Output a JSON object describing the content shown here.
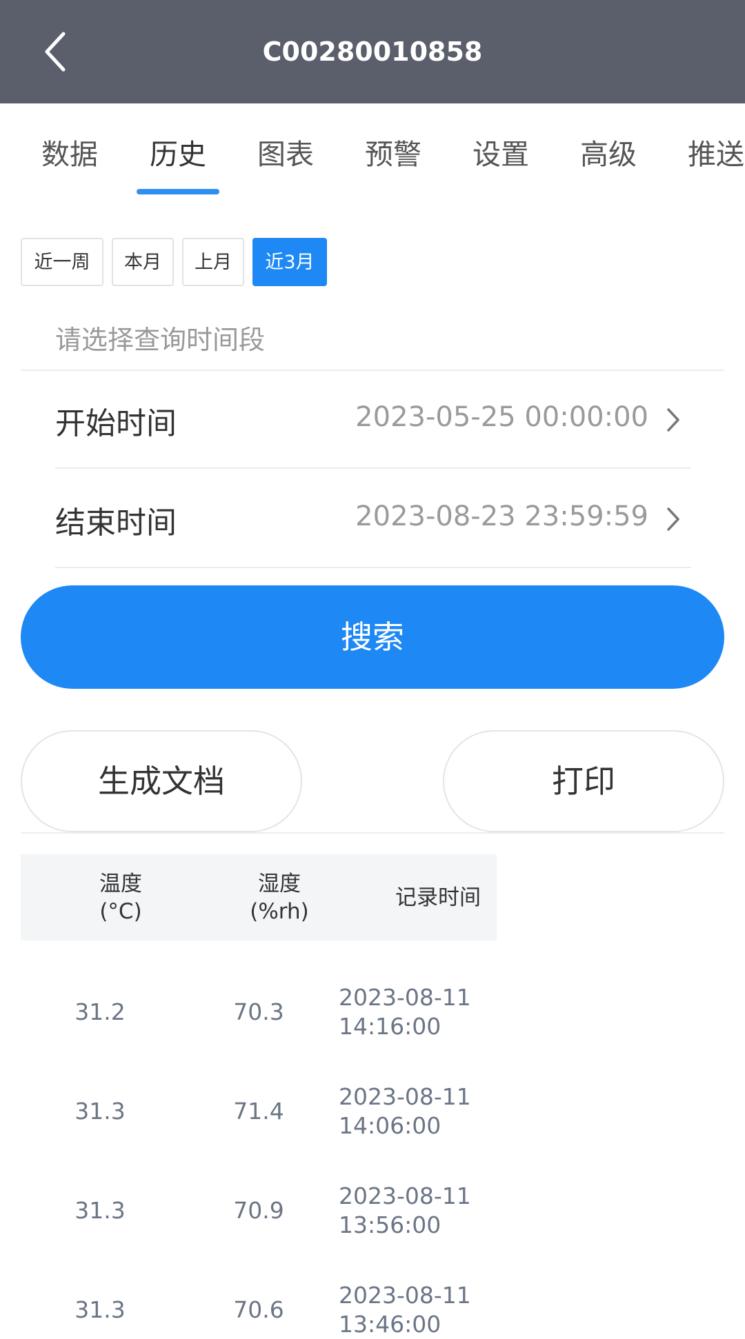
{
  "header": {
    "title": "C00280010858",
    "back_icon": "chevron-left-icon"
  },
  "tabs": [
    {
      "label": "数据",
      "active": false
    },
    {
      "label": "历史",
      "active": true
    },
    {
      "label": "图表",
      "active": false
    },
    {
      "label": "预警",
      "active": false
    },
    {
      "label": "设置",
      "active": false
    },
    {
      "label": "高级",
      "active": false
    },
    {
      "label": "推送",
      "active": false
    }
  ],
  "quick_ranges": [
    {
      "label": "近一周",
      "selected": false
    },
    {
      "label": "本月",
      "selected": false
    },
    {
      "label": "上月",
      "selected": false
    },
    {
      "label": "近3月",
      "selected": true
    }
  ],
  "range_hint": "请选择查询时间段",
  "start": {
    "label": "开始时间",
    "value": "2023-05-25 00:00:00"
  },
  "end": {
    "label": "结束时间",
    "value": "2023-08-23 23:59:59"
  },
  "buttons": {
    "search": "搜索",
    "generate_doc": "生成文档",
    "print": "打印"
  },
  "table": {
    "headers": [
      {
        "line1": "温度",
        "line2": "(°C)"
      },
      {
        "line1": "湿度",
        "line2": "(%rh)"
      },
      {
        "line1": "记录时间",
        "line2": ""
      }
    ],
    "rows": [
      {
        "temp": "31.2",
        "humidity": "70.3",
        "date": "2023-08-11",
        "time": "14:16:00"
      },
      {
        "temp": "31.3",
        "humidity": "71.4",
        "date": "2023-08-11",
        "time": "14:06:00"
      },
      {
        "temp": "31.3",
        "humidity": "70.9",
        "date": "2023-08-11",
        "time": "13:56:00"
      },
      {
        "temp": "31.3",
        "humidity": "70.6",
        "date": "2023-08-11",
        "time": "13:46:00"
      }
    ]
  },
  "colors": {
    "header_bg": "#5b5f6b",
    "accent": "#1e88f5",
    "tab_indicator": "#2f8ff0"
  }
}
